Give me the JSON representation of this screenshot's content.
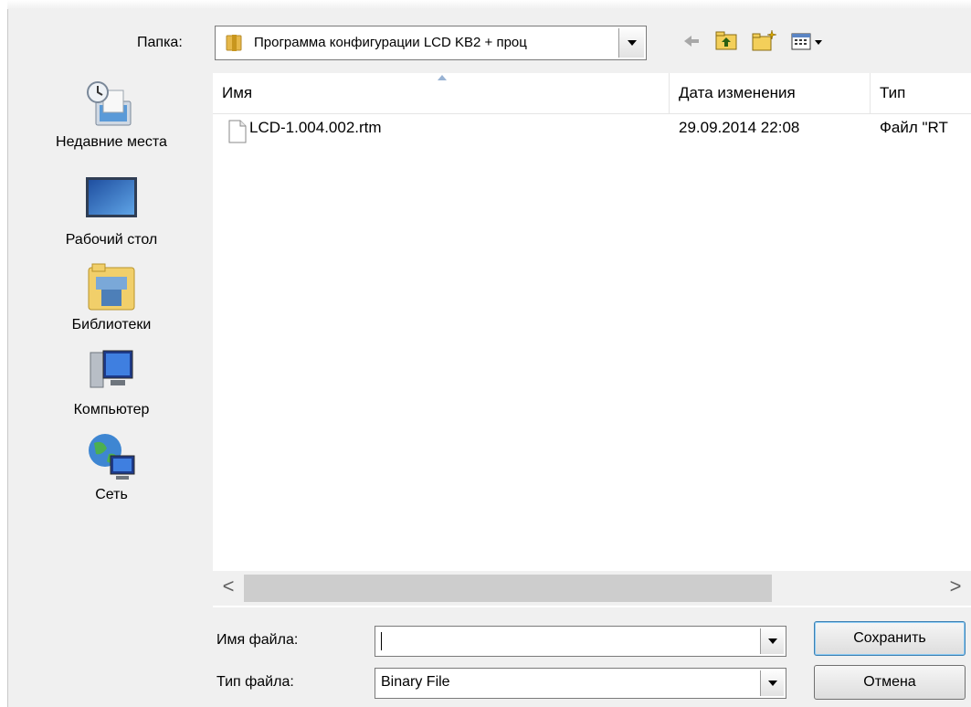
{
  "dialog": {
    "look_in_label": "Папка:",
    "current_folder": "Программа конфигурации LCD KB2 + проц"
  },
  "toolbar": {
    "icons": [
      "back-arrow-icon",
      "up-folder-icon",
      "new-folder-icon",
      "view-menu-icon"
    ]
  },
  "places": [
    {
      "label": "Недавние места",
      "icon": "recent-places-icon"
    },
    {
      "label": "Рабочий стол",
      "icon": "desktop-icon"
    },
    {
      "label": "Библиотеки",
      "icon": "libraries-icon"
    },
    {
      "label": "Компьютер",
      "icon": "computer-icon"
    },
    {
      "label": "Сеть",
      "icon": "network-icon"
    }
  ],
  "file_list": {
    "columns": [
      "Имя",
      "Дата изменения",
      "Тип"
    ],
    "rows": [
      {
        "name": "LCD-1.004.002.rtm",
        "date": "29.09.2014 22:08",
        "type": "Файл \"RT"
      }
    ]
  },
  "scrollbar": {
    "left_glyph": "<",
    "right_glyph": ">"
  },
  "filename": {
    "label": "Имя файла:",
    "value": ""
  },
  "filetype": {
    "label": "Тип файла:",
    "value": "Binary File"
  },
  "buttons": {
    "save": "Сохранить",
    "cancel": "Отмена"
  },
  "colors": {
    "window_bg": "#f0f0f0",
    "list_bg": "#ffffff",
    "folder": "#e6b84a",
    "default_button_border": "#3c7fb1"
  }
}
